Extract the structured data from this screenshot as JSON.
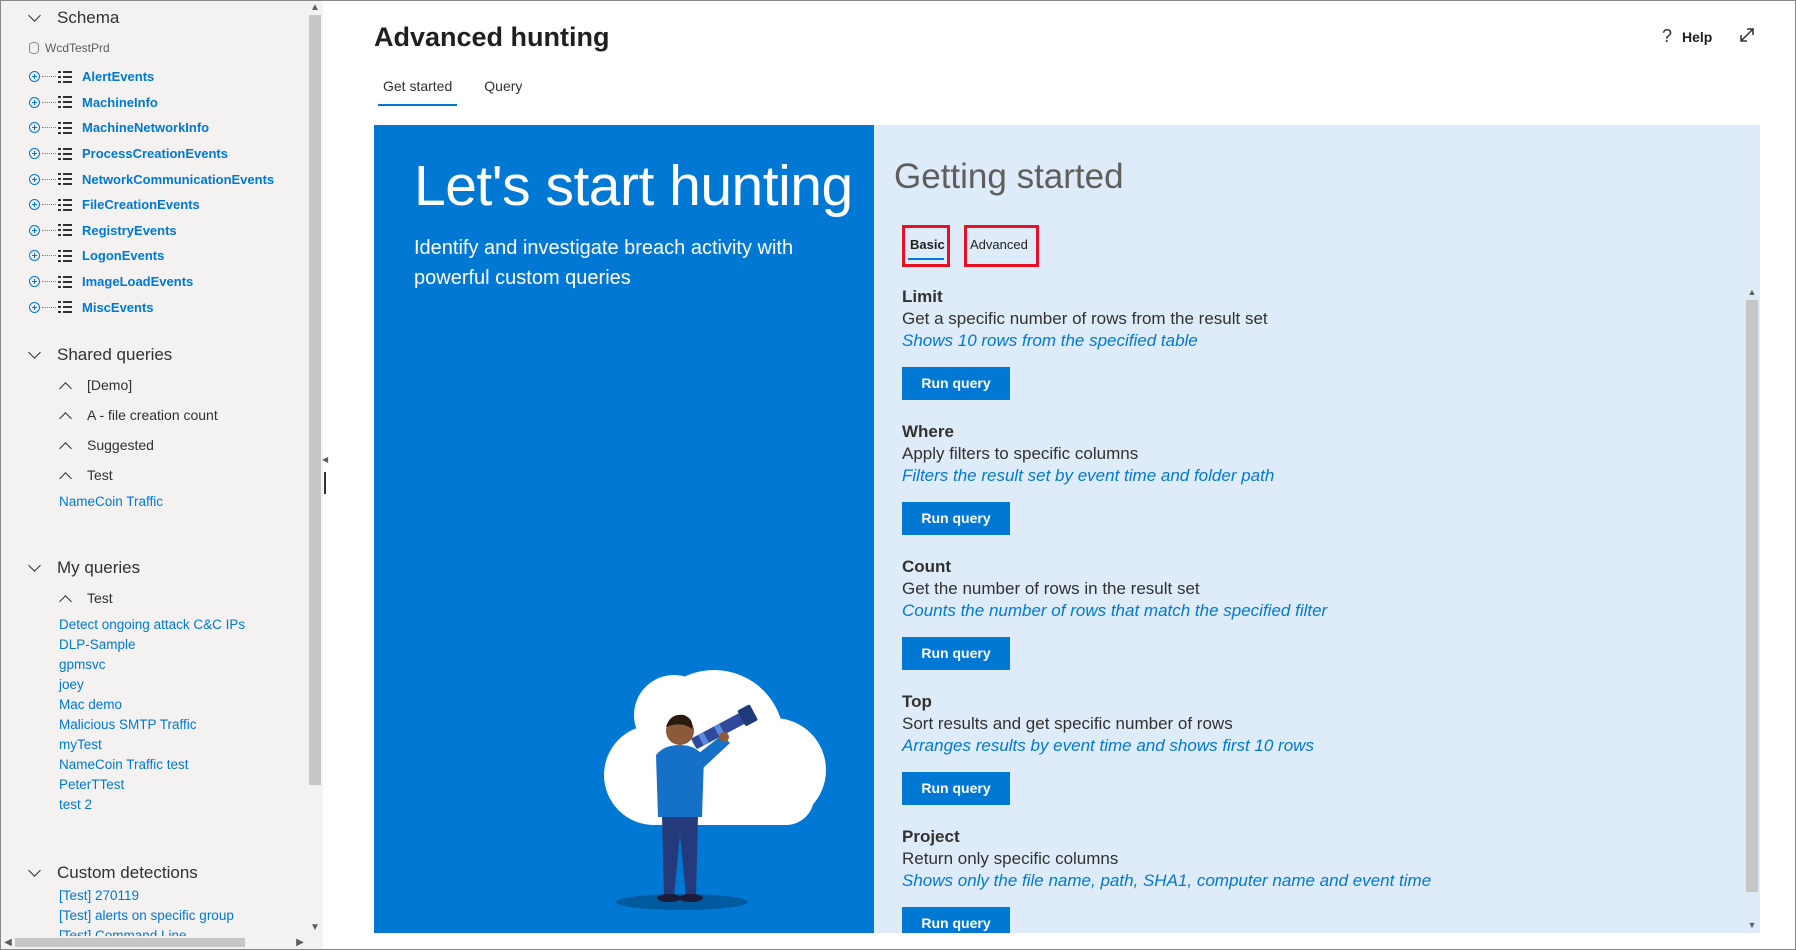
{
  "sidebar": {
    "schema": {
      "title": "Schema",
      "database": "WcdTestPrd",
      "tables": [
        "AlertEvents",
        "MachineInfo",
        "MachineNetworkInfo",
        "ProcessCreationEvents",
        "NetworkCommunicationEvents",
        "FileCreationEvents",
        "RegistryEvents",
        "LogonEvents",
        "ImageLoadEvents",
        "MiscEvents"
      ]
    },
    "shared_queries": {
      "title": "Shared queries",
      "folders": [
        "[Demo]",
        "A - file creation count",
        "Suggested",
        "Test"
      ],
      "items": [
        "NameCoin Traffic"
      ]
    },
    "my_queries": {
      "title": "My queries",
      "folders": [
        "Test"
      ],
      "items": [
        "Detect ongoing attack C&C IPs",
        "DLP-Sample",
        "gpmsvc",
        "joey",
        "Mac demo",
        "Malicious SMTP Traffic",
        "myTest",
        "NameCoin Traffic test",
        "PeterTTest",
        "test 2"
      ]
    },
    "custom_detections": {
      "title": "Custom detections",
      "items": [
        "[Test] 270119",
        "[Test] alerts on specific group",
        "[Test] Command Line"
      ]
    }
  },
  "header": {
    "title": "Advanced hunting",
    "help_label": "Help",
    "tabs": [
      {
        "label": "Get started",
        "active": true
      },
      {
        "label": "Query",
        "active": false
      }
    ]
  },
  "hero": {
    "title": "Let's start hunting",
    "subtitle": "Identify and investigate breach activity with powerful custom queries"
  },
  "getting_started": {
    "title": "Getting started",
    "tabs": [
      {
        "label": "Basic",
        "active": true
      },
      {
        "label": "Advanced",
        "active": false
      }
    ],
    "run_label": "Run query",
    "queries": [
      {
        "name": "Limit",
        "description": "Get a specific number of rows from the result set",
        "hint": "Shows 10 rows from the specified table"
      },
      {
        "name": "Where",
        "description": "Apply filters to specific columns",
        "hint": "Filters the result set by event time and folder path"
      },
      {
        "name": "Count",
        "description": "Get the number of rows in the result set",
        "hint": "Counts the number of rows that match the specified filter"
      },
      {
        "name": "Top",
        "description": "Sort results and get specific number of rows",
        "hint": "Arranges results by event time and shows first 10 rows"
      },
      {
        "name": "Project",
        "description": "Return only specific columns",
        "hint": "Shows only the file name, path, SHA1, computer name and event time"
      }
    ]
  },
  "colors": {
    "accent": "#0078d4",
    "panel_bg": "#deecf9",
    "highlight": "#e81123"
  }
}
